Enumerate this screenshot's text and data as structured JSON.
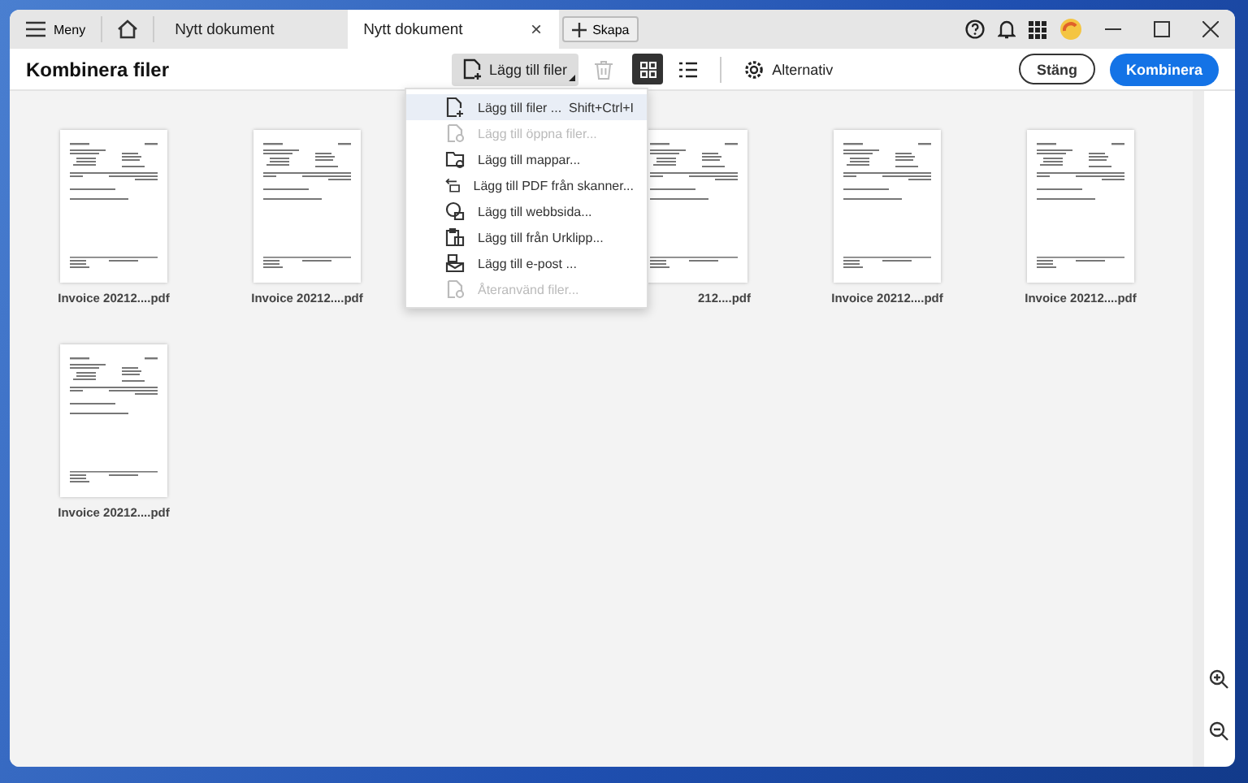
{
  "tabbar": {
    "menu": "Meny",
    "tabs": [
      {
        "label": "Nytt dokument",
        "selected": false
      },
      {
        "label": "Nytt dokument",
        "selected": true
      }
    ],
    "close": "×",
    "create": "Skapa"
  },
  "header": {
    "title": "Kombinera filer",
    "add": "Lägg till filer",
    "view": [
      {
        "kind": "grid",
        "selected": true
      },
      {
        "kind": "list",
        "selected": false
      }
    ],
    "options": "Alternativ",
    "close": "Stäng",
    "combine": "Kombinera"
  },
  "files": [
    {
      "kind": "file",
      "label": "Invoice 20212....pdf"
    },
    {
      "kind": "file",
      "label": "Invoice 20212....pdf"
    },
    {
      "kind": "covered"
    },
    {
      "kind": "partial",
      "label": "212....pdf"
    },
    {
      "kind": "file",
      "label": "Invoice 20212....pdf"
    },
    {
      "kind": "file",
      "label": "Invoice 20212....pdf"
    },
    {
      "kind": "file",
      "label": "Invoice 20212....pdf"
    }
  ],
  "menu": [
    {
      "kind": "file",
      "label": "Lägg till filer ...",
      "shortcut": "Shift+Ctrl+I",
      "selected": true,
      "disabled": false
    },
    {
      "kind": "open",
      "label": "Lägg till öppna filer...",
      "selected": false,
      "disabled": true
    },
    {
      "kind": "folder",
      "label": "Lägg till mappar...",
      "selected": false,
      "disabled": false
    },
    {
      "kind": "scanner",
      "label": "Lägg till PDF från skanner...",
      "selected": false,
      "disabled": false
    },
    {
      "kind": "web",
      "label": "Lägg till webbsida...",
      "selected": false,
      "disabled": false
    },
    {
      "kind": "clipboard",
      "label": "Lägg till från Urklipp...",
      "selected": false,
      "disabled": false
    },
    {
      "kind": "mail",
      "label": "Lägg till e-post ...",
      "selected": false,
      "disabled": false
    },
    {
      "kind": "reuse",
      "label": "Återanvänd filer...",
      "selected": false,
      "disabled": true
    }
  ]
}
